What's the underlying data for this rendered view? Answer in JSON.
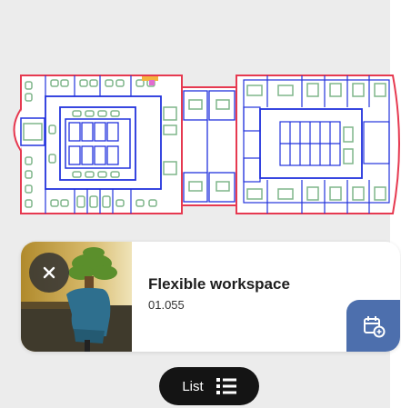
{
  "space": {
    "name": "Flexible workspace",
    "code": "01.055"
  },
  "list_button": {
    "label": "List"
  },
  "icons": {
    "close": "close-icon",
    "book": "calendar-add-icon",
    "list": "list-icon"
  },
  "colors": {
    "wall": "#e63950",
    "room_outline": "#2233dd",
    "furniture": "#7fb58a",
    "book_button": "#4d6fad",
    "list_button": "#141414"
  }
}
